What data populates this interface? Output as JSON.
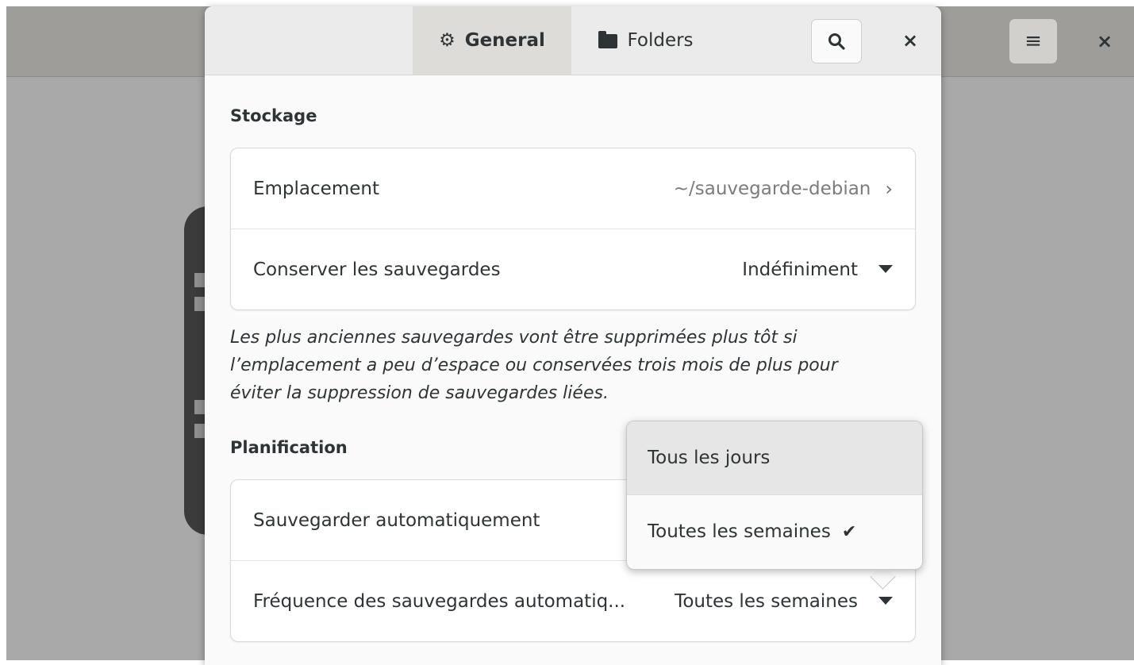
{
  "dialog": {
    "tabs": [
      {
        "label": "General",
        "icon": "gear-icon"
      },
      {
        "label": "Folders",
        "icon": "folder-icon"
      }
    ],
    "close_label": "×"
  },
  "storage": {
    "title": "Stockage",
    "location_label": "Emplacement",
    "location_value": "~/sauvegarde-debian",
    "keep_label": "Conserver les sauvegardes",
    "keep_value": "Indéfiniment",
    "note": "Les plus anciennes sauvegardes vont être supprimées plus tôt si l’emplacement a peu d’espace ou conservées trois mois de plus pour éviter la suppression de sauvegardes liées."
  },
  "schedule": {
    "title": "Planification",
    "auto_label": "Sauvegarder automatiquement",
    "freq_label": "Fréquence des sauvegardes automatiq...",
    "freq_value": "Toutes les semaines"
  },
  "popover": {
    "options": [
      {
        "label": "Tous les jours",
        "selected": false
      },
      {
        "label": "Toutes les semaines",
        "selected": true
      }
    ]
  },
  "background": {
    "menu_icon": "≡",
    "close_label": "×"
  }
}
